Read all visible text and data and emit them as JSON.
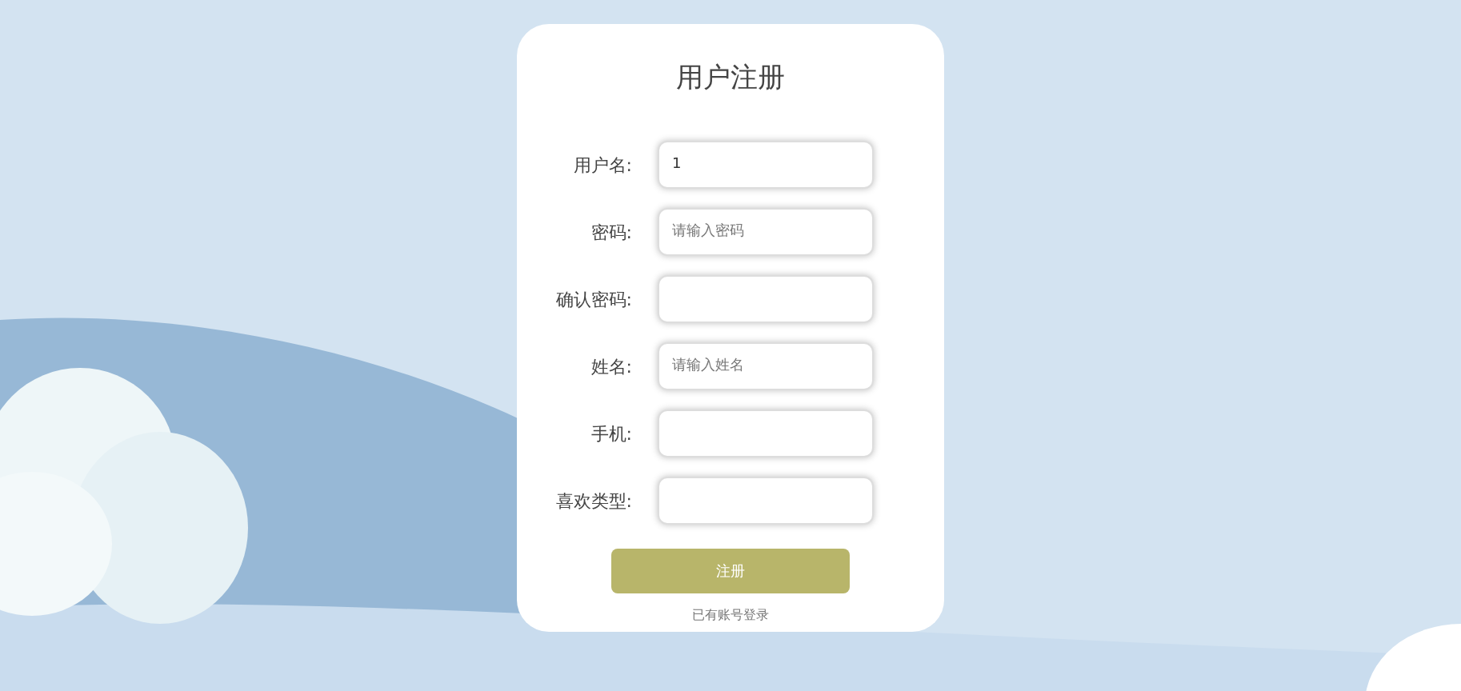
{
  "form": {
    "title": "用户注册",
    "fields": [
      {
        "label": "用户名:",
        "value": "1"
      },
      {
        "label": "密码:",
        "placeholder": "请输入密码"
      },
      {
        "label": "确认密码:"
      },
      {
        "label": "姓名:",
        "placeholder": "请输入姓名"
      },
      {
        "label": "手机:"
      },
      {
        "label": "喜欢类型:"
      }
    ],
    "submit": "注册",
    "login_link": "已有账号登录"
  }
}
